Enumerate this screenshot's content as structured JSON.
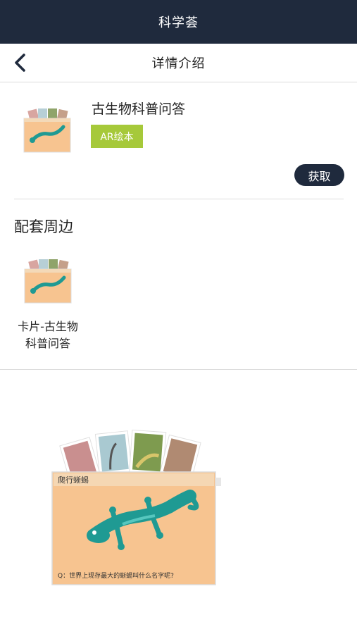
{
  "header": {
    "title": "科学荟"
  },
  "nav": {
    "title": "详情介绍",
    "back_icon": "chevron-left-icon"
  },
  "product": {
    "name": "古生物科普问答",
    "tag": "AR绘本",
    "get_label": "获取"
  },
  "section": {
    "title": "配套周边",
    "items": [
      {
        "label": "卡片-古生物科普问答"
      }
    ]
  },
  "preview": {
    "card_title": "爬行蜥蜴",
    "card_question": "Q：世界上现存最大的蜥蜴叫什么名字呢?"
  },
  "colors": {
    "header_bg": "#1f2a3d",
    "tag_bg": "#a6c93a",
    "card_bg": "#f7c490",
    "lizard": "#1f9a93"
  }
}
